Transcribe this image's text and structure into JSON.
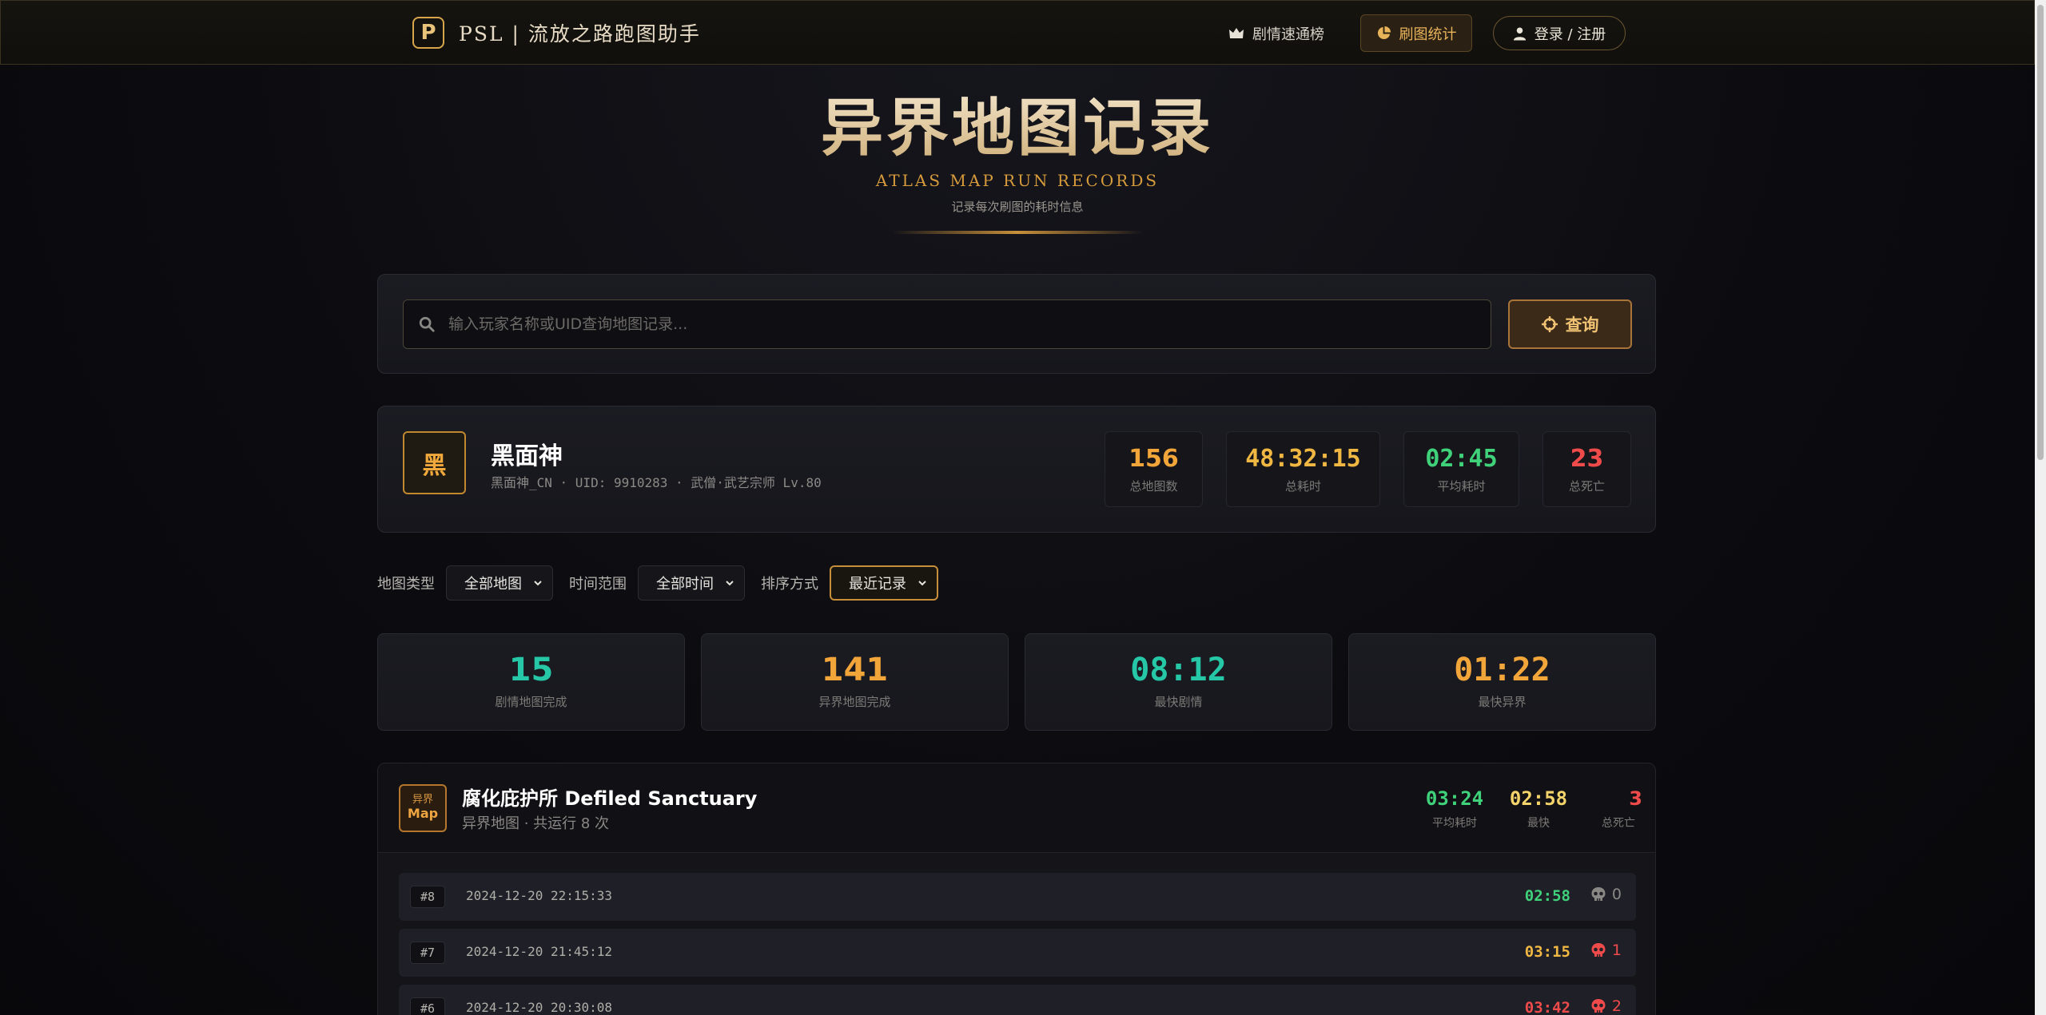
{
  "nav": {
    "logo_letter": "P",
    "brand": "PSL | 流放之路跑图助手",
    "links": [
      {
        "label": "剧情速通榜",
        "icon": "crown-icon"
      },
      {
        "label": "刷图统计",
        "icon": "pie-chart-icon"
      },
      {
        "label": "登录 / 注册",
        "icon": "user-icon"
      }
    ]
  },
  "header": {
    "title": "异界地图记录",
    "subtitle_en": "ATLAS MAP RUN RECORDS",
    "subtitle_cn": "记录每次刷图的耗时信息"
  },
  "search": {
    "placeholder": "输入玩家名称或UID查询地图记录...",
    "value": "",
    "button_label": "查询"
  },
  "player": {
    "avatar_char": "黑",
    "name": "黑面神",
    "meta": "黑面神_CN · UID: 9910283 · 武僧·武艺宗师 Lv.80",
    "stats": [
      {
        "value": "156",
        "label": "总地图数",
        "color": "#f2a63a"
      },
      {
        "value": "48:32:15",
        "label": "总耗时",
        "color": "#f0b843"
      },
      {
        "value": "02:45",
        "label": "平均耗时",
        "color": "#3fd27a"
      },
      {
        "value": "23",
        "label": "总死亡",
        "color": "#ef4b4b"
      }
    ]
  },
  "filters": [
    {
      "label": "地图类型",
      "value": "全部地图"
    },
    {
      "label": "时间范围",
      "value": "全部时间"
    },
    {
      "label": "排序方式",
      "value": "最近记录"
    }
  ],
  "summary": [
    {
      "value": "15",
      "label": "剧情地图完成",
      "color": "#25c7a6"
    },
    {
      "value": "141",
      "label": "异界地图完成",
      "color": "#f2a63a"
    },
    {
      "value": "08:12",
      "label": "最快剧情",
      "color": "#25c7a6"
    },
    {
      "value": "01:22",
      "label": "最快异界",
      "color": "#f2a63a"
    }
  ],
  "map": {
    "badge_top": "异界",
    "badge_bottom": "Map",
    "name": "腐化庇护所 Defiled Sanctuary",
    "sub": "异界地图 · 共运行 8 次",
    "stats": [
      {
        "value": "03:24",
        "label": "平均耗时",
        "color": "#3fd27a"
      },
      {
        "value": "02:58",
        "label": "最快",
        "color": "#f4d46a"
      },
      {
        "value": "3",
        "label": "总死亡",
        "color": "#ef4b4b"
      }
    ],
    "runs": [
      {
        "idx": "#8",
        "date": "2024-12-20 22:15:33",
        "time": "02:58",
        "deaths": "0",
        "time_color": "#3fd27a",
        "death_color": "#8a8884"
      },
      {
        "idx": "#7",
        "date": "2024-12-20 21:45:12",
        "time": "03:15",
        "deaths": "1",
        "time_color": "#f0b843",
        "death_color": "#ef4b4b"
      },
      {
        "idx": "#6",
        "date": "2024-12-20 20:30:08",
        "time": "03:42",
        "deaths": "2",
        "time_color": "#ef4b4b",
        "death_color": "#ef4b4b"
      }
    ]
  }
}
